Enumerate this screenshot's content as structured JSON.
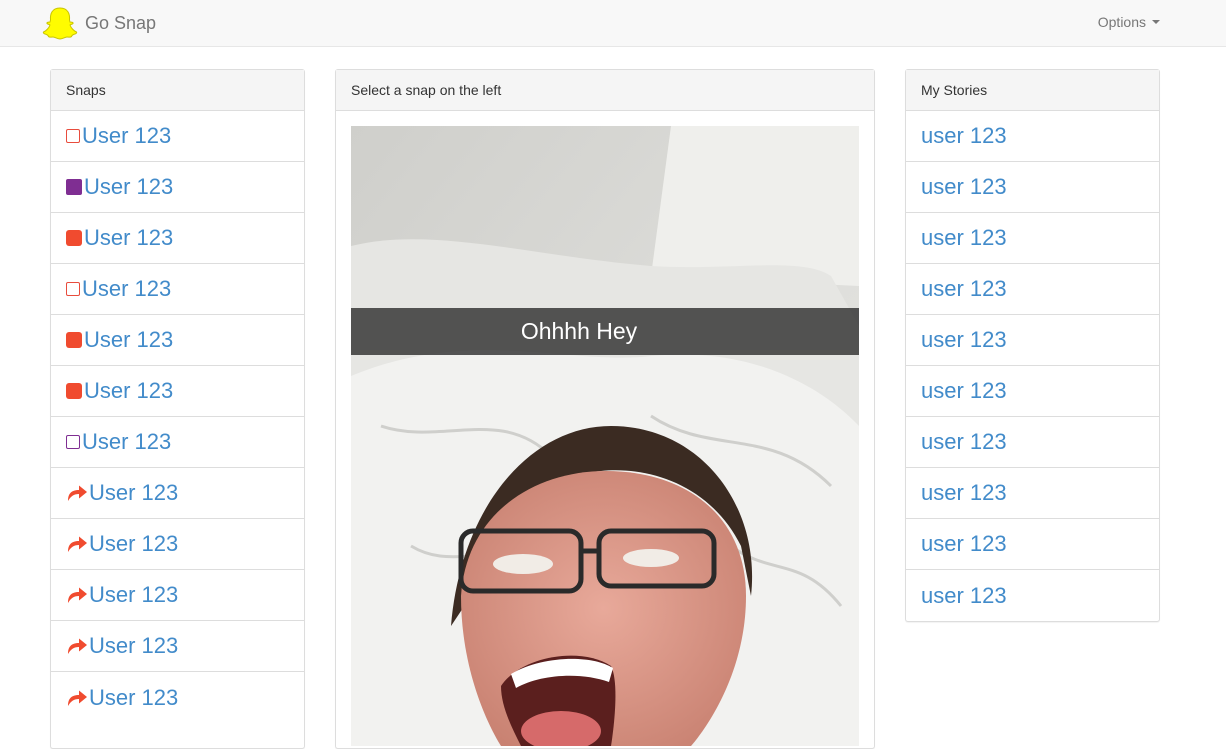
{
  "app": {
    "title": "Go Snap",
    "options_label": "Options"
  },
  "snaps": {
    "heading": "Snaps",
    "items": [
      {
        "icon": "outline-red-square-icon",
        "label": "User 123"
      },
      {
        "icon": "filled-purple-square-icon",
        "label": "User 123"
      },
      {
        "icon": "filled-red-square-icon",
        "label": "User 123"
      },
      {
        "icon": "outline-red-square-icon",
        "label": "User 123"
      },
      {
        "icon": "filled-red-square-icon",
        "label": "User 123"
      },
      {
        "icon": "filled-red-square-icon",
        "label": "User 123"
      },
      {
        "icon": "outline-purple-square-icon",
        "label": "User 123"
      },
      {
        "icon": "reply-arrow-icon",
        "label": "User 123"
      },
      {
        "icon": "reply-arrow-icon",
        "label": "User 123"
      },
      {
        "icon": "reply-arrow-icon",
        "label": "User 123"
      },
      {
        "icon": "reply-arrow-icon",
        "label": "User 123"
      },
      {
        "icon": "reply-arrow-icon",
        "label": "User 123"
      }
    ]
  },
  "viewer": {
    "heading": "Select a snap on the left",
    "caption": "Ohhhh Hey"
  },
  "stories": {
    "heading": "My Stories",
    "items": [
      {
        "label": "user 123"
      },
      {
        "label": "user 123"
      },
      {
        "label": "user 123"
      },
      {
        "label": "user 123"
      },
      {
        "label": "user 123"
      },
      {
        "label": "user 123"
      },
      {
        "label": "user 123"
      },
      {
        "label": "user 123"
      },
      {
        "label": "user 123"
      },
      {
        "label": "user 123"
      }
    ]
  },
  "colors": {
    "link": "#428bca",
    "red": "#f04b2f",
    "purple": "#7f2e92",
    "snapchat_yellow": "#fffc00"
  }
}
